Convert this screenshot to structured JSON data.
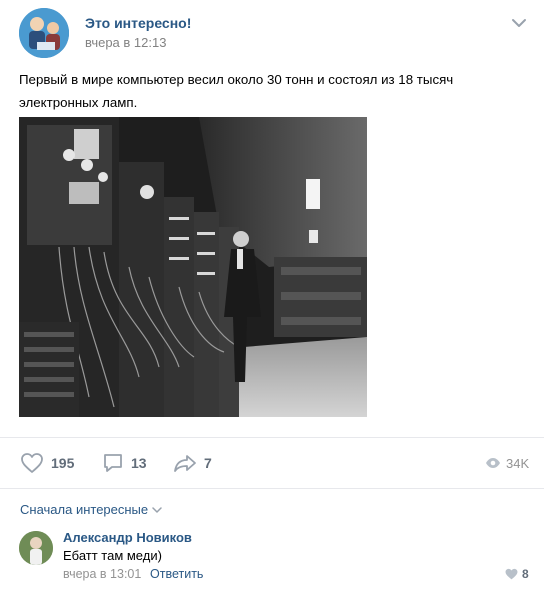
{
  "post": {
    "group_name": "Это интересно!",
    "time": "вчера в 12:13",
    "text": "Первый в мире компьютер весил около 30 тонн и состоял из 18 тысяч электронных ламп.",
    "photo_icon": "black-and-white-photo-of-early-computer"
  },
  "actions": {
    "likes": "195",
    "comments": "13",
    "shares": "7",
    "views": "34K"
  },
  "comments_section": {
    "sort_label": "Сначала интересные",
    "comment": {
      "author": "Александр Новиков",
      "text": "Ебатт там меди)",
      "time": "вчера в 13:01",
      "reply_label": "Ответить",
      "likes": "8"
    }
  },
  "colors": {
    "link": "#2a5885",
    "muted": "#828282",
    "icon": "#99a2ad",
    "divider": "#e7e8ec"
  }
}
